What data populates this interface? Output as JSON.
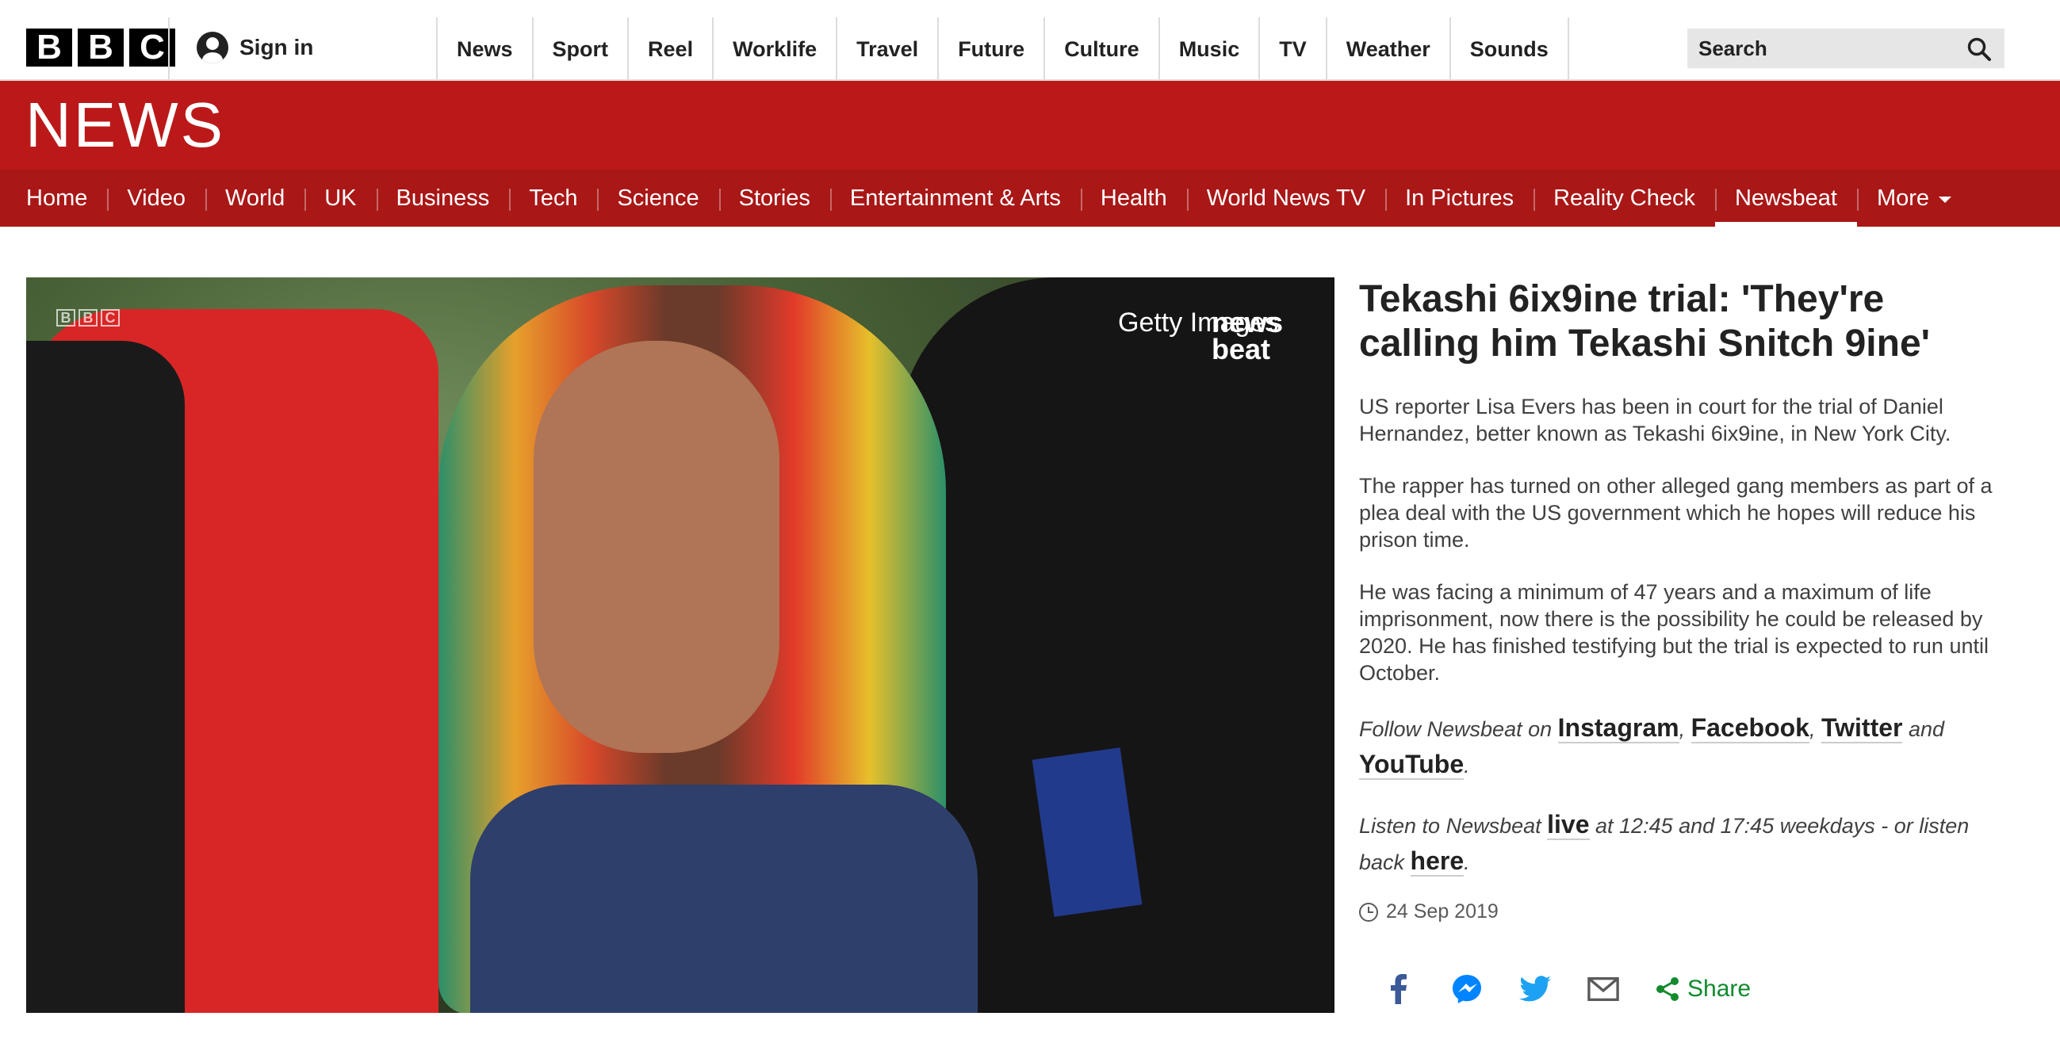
{
  "brand": {
    "logo_letters": [
      "B",
      "B",
      "C"
    ]
  },
  "signin": {
    "label": "Sign in"
  },
  "top_nav": [
    "News",
    "Sport",
    "Reel",
    "Worklife",
    "Travel",
    "Future",
    "Culture",
    "Music",
    "TV",
    "Weather",
    "Sounds"
  ],
  "search": {
    "placeholder": "Search"
  },
  "banner": {
    "title": "NEWS"
  },
  "section_nav": {
    "items": [
      "Home",
      "Video",
      "World",
      "UK",
      "Business",
      "Tech",
      "Science",
      "Stories",
      "Entertainment & Arts",
      "Health",
      "World News TV",
      "In Pictures",
      "Reality Check",
      "Newsbeat",
      "More"
    ],
    "active": "Newsbeat"
  },
  "media": {
    "watermark_letters": [
      "B",
      "B",
      "C"
    ],
    "credit": "Getty Images",
    "brand_line1": "news",
    "brand_line2": "beat"
  },
  "article": {
    "headline": "Tekashi 6ix9ine trial: 'They're calling him Tekashi Snitch 9ine'",
    "paragraphs": [
      "US reporter Lisa Evers has been in court for the trial of Daniel Hernandez, better known as Tekashi 6ix9ine, in New York City.",
      "The rapper has turned on other alleged gang members as part of a plea deal with the US government which he hopes will reduce his prison time.",
      "He was facing a minimum of 47 years and a maximum of life imprisonment, now there is the possibility he could be released by 2020. He has finished testifying but the trial is expected to run until October."
    ],
    "follow": {
      "prefix": "Follow Newsbeat on ",
      "links": [
        "Instagram",
        "Facebook",
        "Twitter",
        "YouTube"
      ],
      "sep1": ", ",
      "sep2": ", ",
      "and": " and ",
      "end": "."
    },
    "listen": {
      "prefix": "Listen to Newsbeat ",
      "live": "live",
      "middle": " at 12:45 and 17:45 weekdays - or listen back ",
      "here": "here",
      "end": "."
    },
    "date": "24 Sep 2019"
  },
  "share": {
    "label": "Share",
    "icons": [
      "facebook-icon",
      "messenger-icon",
      "twitter-icon",
      "email-icon",
      "share-icon"
    ]
  },
  "colors": {
    "brand_red": "#bb1919",
    "nav_red": "#a91717",
    "share_green": "#128a2d"
  }
}
